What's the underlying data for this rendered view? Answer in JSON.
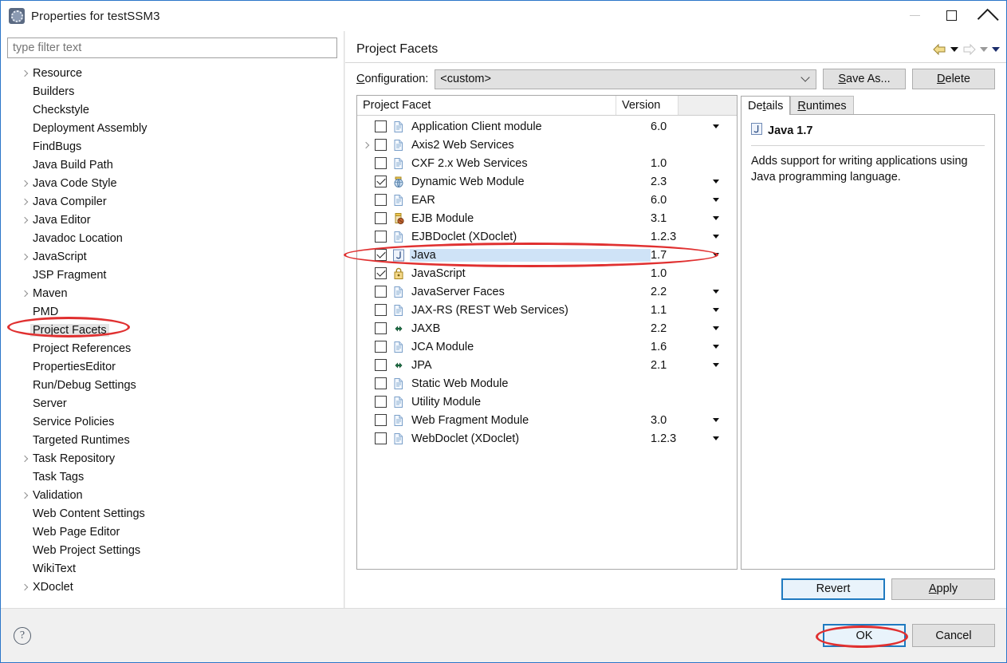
{
  "window": {
    "title": "Properties for testSSM3",
    "icon": "properties-icon",
    "minimize": "—",
    "maximize": "☐",
    "close": "✕"
  },
  "sidebar": {
    "filter_placeholder": "type filter text",
    "filter_value": "",
    "selected": "Project Facets",
    "items": [
      {
        "label": "Resource",
        "expandable": true
      },
      {
        "label": "Builders",
        "expandable": false
      },
      {
        "label": "Checkstyle",
        "expandable": false
      },
      {
        "label": "Deployment Assembly",
        "expandable": false
      },
      {
        "label": "FindBugs",
        "expandable": false
      },
      {
        "label": "Java Build Path",
        "expandable": false
      },
      {
        "label": "Java Code Style",
        "expandable": true
      },
      {
        "label": "Java Compiler",
        "expandable": true
      },
      {
        "label": "Java Editor",
        "expandable": true
      },
      {
        "label": "Javadoc Location",
        "expandable": false
      },
      {
        "label": "JavaScript",
        "expandable": true
      },
      {
        "label": "JSP Fragment",
        "expandable": false
      },
      {
        "label": "Maven",
        "expandable": true
      },
      {
        "label": "PMD",
        "expandable": false
      },
      {
        "label": "Project Facets",
        "expandable": false
      },
      {
        "label": "Project References",
        "expandable": false
      },
      {
        "label": "PropertiesEditor",
        "expandable": false
      },
      {
        "label": "Run/Debug Settings",
        "expandable": false
      },
      {
        "label": "Server",
        "expandable": false
      },
      {
        "label": "Service Policies",
        "expandable": false
      },
      {
        "label": "Targeted Runtimes",
        "expandable": false
      },
      {
        "label": "Task Repository",
        "expandable": true
      },
      {
        "label": "Task Tags",
        "expandable": false
      },
      {
        "label": "Validation",
        "expandable": true
      },
      {
        "label": "Web Content Settings",
        "expandable": false
      },
      {
        "label": "Web Page Editor",
        "expandable": false
      },
      {
        "label": "Web Project Settings",
        "expandable": false
      },
      {
        "label": "WikiText",
        "expandable": false
      },
      {
        "label": "XDoclet",
        "expandable": true
      }
    ]
  },
  "page": {
    "title": "Project Facets",
    "nav": {
      "back_icon": "arrow-back-icon",
      "back_menu_icon": "chevron-down-icon",
      "forward_icon": "arrow-forward-icon",
      "forward_menu_icon": "chevron-down-icon",
      "view_menu_icon": "chevron-down-icon"
    },
    "configuration": {
      "label": "Configuration:",
      "label_mnemonic": "C",
      "value": "<custom>",
      "dropdown_icon": "chevron-down-icon",
      "save_as": "Save As...",
      "save_as_mnemonic": "S",
      "delete": "Delete",
      "delete_mnemonic": "D"
    }
  },
  "facets": {
    "columns": [
      "Project Facet",
      "Version",
      ""
    ],
    "selected": "Java",
    "rows": [
      {
        "name": "Application Client module",
        "version": "6.0",
        "checked": false,
        "expandable": false,
        "menu": true,
        "icon": "doc-icon"
      },
      {
        "name": "Axis2 Web Services",
        "version": "",
        "checked": false,
        "expandable": true,
        "menu": false,
        "icon": "doc-icon"
      },
      {
        "name": "CXF 2.x Web Services",
        "version": "1.0",
        "checked": false,
        "expandable": false,
        "menu": false,
        "icon": "doc-icon"
      },
      {
        "name": "Dynamic Web Module",
        "version": "2.3",
        "checked": true,
        "expandable": false,
        "menu": true,
        "icon": "globe-icon"
      },
      {
        "name": "EAR",
        "version": "6.0",
        "checked": false,
        "expandable": false,
        "menu": true,
        "icon": "doc-icon"
      },
      {
        "name": "EJB Module",
        "version": "3.1",
        "checked": false,
        "expandable": false,
        "menu": true,
        "icon": "bean-icon"
      },
      {
        "name": "EJBDoclet (XDoclet)",
        "version": "1.2.3",
        "checked": false,
        "expandable": false,
        "menu": true,
        "icon": "doc-icon"
      },
      {
        "name": "Java",
        "version": "1.7",
        "checked": true,
        "expandable": false,
        "menu": true,
        "icon": "java-icon"
      },
      {
        "name": "JavaScript",
        "version": "1.0",
        "checked": true,
        "expandable": false,
        "menu": false,
        "icon": "js-icon"
      },
      {
        "name": "JavaServer Faces",
        "version": "2.2",
        "checked": false,
        "expandable": false,
        "menu": true,
        "icon": "doc-icon"
      },
      {
        "name": "JAX-RS (REST Web Services)",
        "version": "1.1",
        "checked": false,
        "expandable": false,
        "menu": true,
        "icon": "doc-icon"
      },
      {
        "name": "JAXB",
        "version": "2.2",
        "checked": false,
        "expandable": false,
        "menu": true,
        "icon": "arrows-icon"
      },
      {
        "name": "JCA Module",
        "version": "1.6",
        "checked": false,
        "expandable": false,
        "menu": true,
        "icon": "doc-icon"
      },
      {
        "name": "JPA",
        "version": "2.1",
        "checked": false,
        "expandable": false,
        "menu": true,
        "icon": "arrows-icon"
      },
      {
        "name": "Static Web Module",
        "version": "",
        "checked": false,
        "expandable": false,
        "menu": false,
        "icon": "doc-icon"
      },
      {
        "name": "Utility Module",
        "version": "",
        "checked": false,
        "expandable": false,
        "menu": false,
        "icon": "doc-icon"
      },
      {
        "name": "Web Fragment Module",
        "version": "3.0",
        "checked": false,
        "expandable": false,
        "menu": true,
        "icon": "doc-icon"
      },
      {
        "name": "WebDoclet (XDoclet)",
        "version": "1.2.3",
        "checked": false,
        "expandable": false,
        "menu": true,
        "icon": "doc-icon"
      }
    ]
  },
  "details": {
    "tabs": [
      {
        "label": "Details",
        "mnemonic": "t",
        "active": true
      },
      {
        "label": "Runtimes",
        "mnemonic": "R",
        "active": false
      }
    ],
    "title": "Java 1.7",
    "title_icon": "java-icon",
    "description": "Adds support for writing applications using Java programming language."
  },
  "apply_bar": {
    "revert": "Revert",
    "apply": "Apply",
    "apply_mnemonic": "A"
  },
  "footer": {
    "help_icon": "help-icon",
    "help_glyph": "?",
    "ok": "OK",
    "cancel": "Cancel"
  },
  "annotations": {
    "color": "#e03030",
    "marks": [
      {
        "name": "project-facets-sidebar-highlight"
      },
      {
        "name": "java-facet-row-highlight"
      },
      {
        "name": "ok-button-highlight"
      }
    ]
  }
}
